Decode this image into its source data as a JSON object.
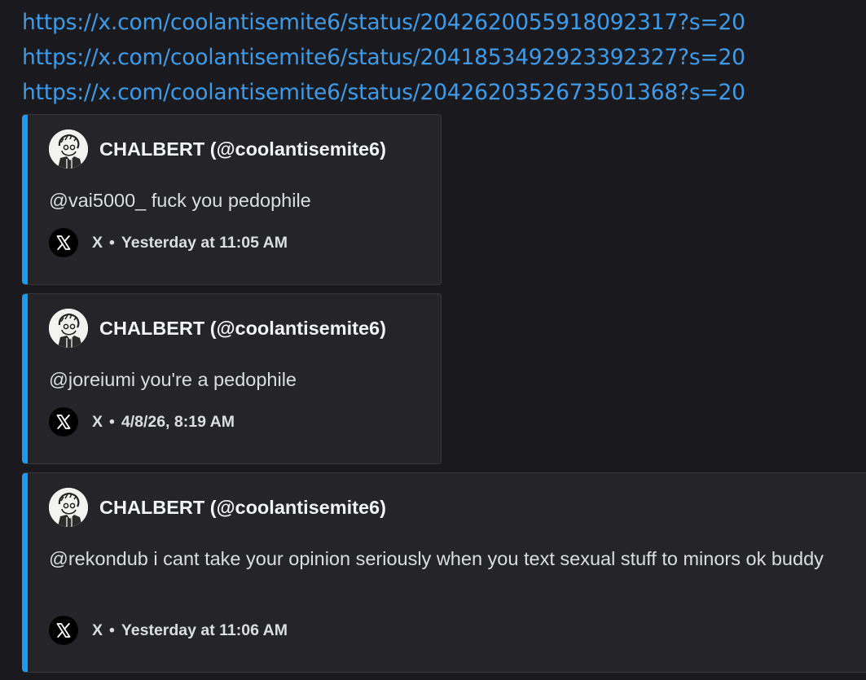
{
  "links": [
    "https://x.com/coolantisemite6/status/2042620055918092317?s=20",
    "https://x.com/coolantisemite6/status/2041853492923392327?s=20",
    "https://x.com/coolantisemite6/status/2042620352673501368?s=20"
  ],
  "embeds": [
    {
      "author": "CHALBERT (@coolantisemite6)",
      "text": "@vai5000_ fuck you pedophile",
      "provider": "X",
      "separator": "•",
      "timestamp": "Yesterday at 11:05 AM"
    },
    {
      "author": "CHALBERT (@coolantisemite6)",
      "text": "@joreiumi you're a pedophile",
      "provider": "X",
      "separator": "•",
      "timestamp": "4/8/26, 8:19 AM"
    },
    {
      "author": "CHALBERT (@coolantisemite6)",
      "text": "@rekondub i cant take your opinion seriously when you text sexual stuff to minors ok buddy",
      "provider": "X",
      "separator": "•",
      "timestamp": "Yesterday at 11:06 AM"
    }
  ],
  "colors": {
    "background": "#1a1a1e",
    "embed_background": "#242429",
    "accent": "#1d9bf0",
    "link": "#3d9be9"
  },
  "icons": {
    "avatar": "user-avatar-icon",
    "provider": "x-logo-icon"
  }
}
